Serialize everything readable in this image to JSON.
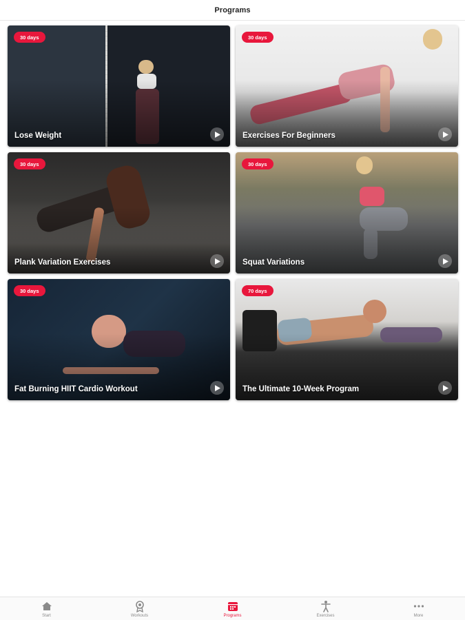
{
  "header": {
    "title": "Programs"
  },
  "programs": [
    {
      "badge": "30 days",
      "title": "Lose Weight"
    },
    {
      "badge": "30 days",
      "title": "Exercises For Beginners"
    },
    {
      "badge": "30 days",
      "title": "Plank Variation Exercises"
    },
    {
      "badge": "30 days",
      "title": "Squat Variations"
    },
    {
      "badge": "30 days",
      "title": "Fat Burning HIIT Cardio Workout"
    },
    {
      "badge": "70 days",
      "title": "The Ultimate 10-Week Program"
    }
  ],
  "tabbar": {
    "items": [
      {
        "label": "Start",
        "icon": "home-icon",
        "active": false
      },
      {
        "label": "Workouts",
        "icon": "award-icon",
        "active": false
      },
      {
        "label": "Programs",
        "icon": "calendar-icon",
        "active": true
      },
      {
        "label": "Exercises",
        "icon": "person-icon",
        "active": false
      },
      {
        "label": "More",
        "icon": "more-icon",
        "active": false
      }
    ]
  },
  "colors": {
    "accent": "#e8173c",
    "inactive": "#8a8a8a"
  }
}
